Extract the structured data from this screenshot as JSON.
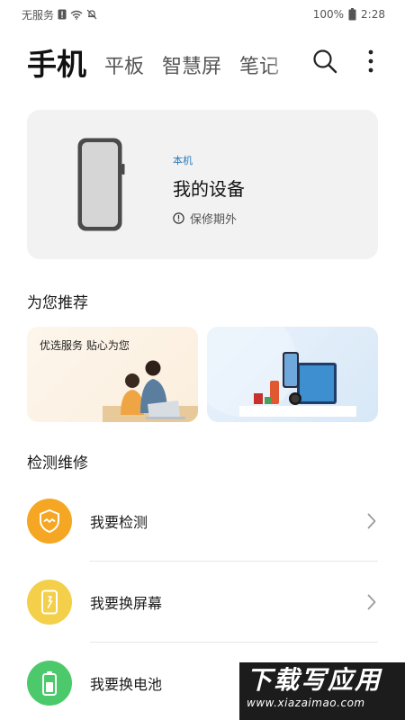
{
  "status_bar": {
    "carrier": "无服务",
    "battery": "100%",
    "time": "2:28"
  },
  "top_tabs": [
    {
      "label": "手机",
      "active": true
    },
    {
      "label": "平板",
      "active": false
    },
    {
      "label": "智慧屏",
      "active": false
    },
    {
      "label": "笔记",
      "active": false
    }
  ],
  "device_card": {
    "tag": "本机",
    "name": "我的设备",
    "warranty": "保修期外"
  },
  "recommend": {
    "title": "为您推荐",
    "banners": [
      {
        "text": "优选服务 贴心为您"
      }
    ]
  },
  "repair": {
    "title": "检测维修",
    "items": [
      {
        "label": "我要检测",
        "icon": "shield-wave-icon",
        "color": "#f5a623"
      },
      {
        "label": "我要换屏幕",
        "icon": "phone-screen-icon",
        "color": "#f3cf4a"
      },
      {
        "label": "我要换电池",
        "icon": "battery-icon",
        "color": "#4cc96a"
      }
    ]
  },
  "watermark": {
    "title": "下载写应用",
    "subtitle": "www.xiazaimao.com"
  },
  "colors": {
    "accent_blue": "#2a7ab8",
    "card_bg": "#f2f2f2",
    "detect_orange": "#f5a623",
    "screen_yellow": "#f3cf4a",
    "battery_green": "#4cc96a"
  }
}
